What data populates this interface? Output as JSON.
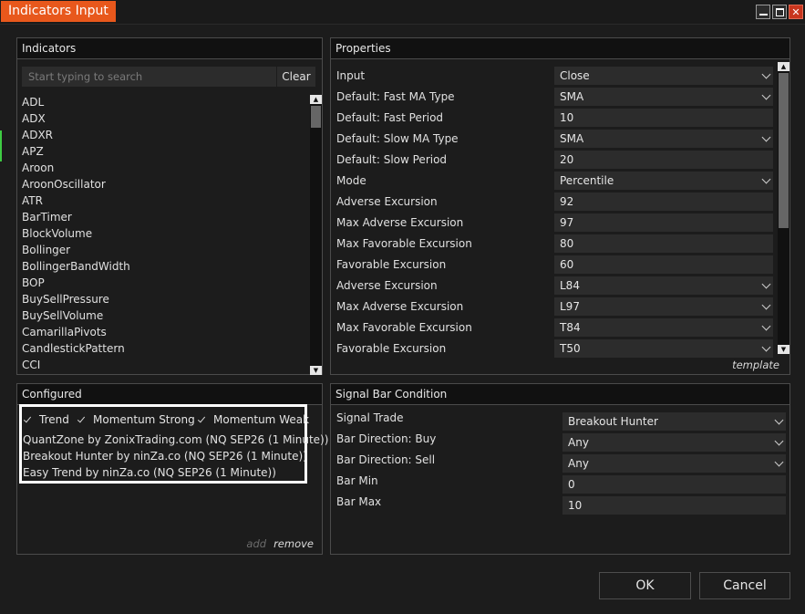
{
  "window": {
    "title": "Indicators Input",
    "min_symbol": "",
    "max_symbol": "",
    "close_symbol": "✕",
    "accent_color": "#e8581c"
  },
  "indicators": {
    "header": "Indicators",
    "search_placeholder": "Start typing to search",
    "search_value": "",
    "clear_label": "Clear",
    "items": [
      "ADL",
      "ADX",
      "ADXR",
      "APZ",
      "Aroon",
      "AroonOscillator",
      "ATR",
      "BarTimer",
      "BlockVolume",
      "Bollinger",
      "BollingerBandWidth",
      "BOP",
      "BuySellPressure",
      "BuySellVolume",
      "CamarillaPivots",
      "CandlestickPattern",
      "CCI"
    ]
  },
  "properties": {
    "header": "Properties",
    "rows": [
      {
        "label": "Input",
        "value": "Close",
        "dropdown": true
      },
      {
        "label": "Default: Fast MA Type",
        "value": "SMA",
        "dropdown": true
      },
      {
        "label": "Default: Fast Period",
        "value": "10",
        "dropdown": false
      },
      {
        "label": "Default: Slow MA Type",
        "value": "SMA",
        "dropdown": true
      },
      {
        "label": "Default: Slow Period",
        "value": "20",
        "dropdown": false
      },
      {
        "label": "Mode",
        "value": "Percentile",
        "dropdown": true
      },
      {
        "label": "Adverse Excursion",
        "value": "92",
        "dropdown": false
      },
      {
        "label": "Max Adverse Excursion",
        "value": "97",
        "dropdown": false
      },
      {
        "label": "Max Favorable Excursion",
        "value": "80",
        "dropdown": false
      },
      {
        "label": "Favorable Excursion",
        "value": "60",
        "dropdown": false
      },
      {
        "label": "Adverse Excursion",
        "value": "L84",
        "dropdown": true
      },
      {
        "label": "Max Adverse Excursion",
        "value": "L97",
        "dropdown": true
      },
      {
        "label": "Max Favorable Excursion",
        "value": "T84",
        "dropdown": true
      },
      {
        "label": "Favorable Excursion",
        "value": "T50",
        "dropdown": true
      }
    ],
    "template_label": "template"
  },
  "configured": {
    "header": "Configured",
    "checkboxes": [
      {
        "label": "Trend",
        "checked": true
      },
      {
        "label": "Momentum Strong",
        "checked": true
      },
      {
        "label": "Momentum Weak",
        "checked": true
      }
    ],
    "items": [
      "QuantZone by ZonixTrading.com (NQ SEP26 (1 Minute))",
      "Breakout Hunter by ninZa.co (NQ SEP26 (1 Minute))",
      "Easy Trend by ninZa.co (NQ SEP26 (1 Minute))"
    ],
    "add_label": "add",
    "remove_label": "remove"
  },
  "signal": {
    "header": "Signal Bar Condition",
    "rows": [
      {
        "label": "Signal Trade",
        "value": "Breakout Hunter",
        "dropdown": true
      },
      {
        "label": "Bar Direction: Buy",
        "value": "Any",
        "dropdown": true
      },
      {
        "label": "Bar Direction: Sell",
        "value": "Any",
        "dropdown": true
      },
      {
        "label": "Bar Min",
        "value": "0",
        "dropdown": false
      },
      {
        "label": "Bar Max",
        "value": "10",
        "dropdown": false
      }
    ]
  },
  "buttons": {
    "ok": "OK",
    "cancel": "Cancel"
  }
}
